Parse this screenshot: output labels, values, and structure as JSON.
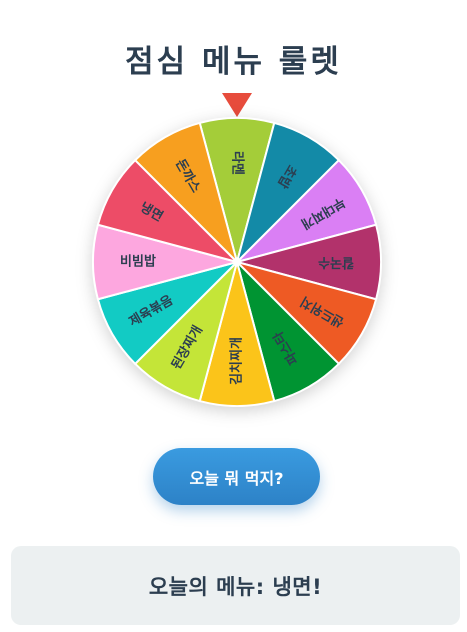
{
  "header": {
    "title": "점심 메뉴 룰렛"
  },
  "wheel": {
    "pointer_color": "#e74c3c",
    "segments": [
      {
        "label": "라멘",
        "color": "#a4cd39"
      },
      {
        "label": "초밥",
        "color": "#138aa7"
      },
      {
        "label": "부대찌개",
        "color": "#da7ff4"
      },
      {
        "label": "칼국수",
        "color": "#b2326b"
      },
      {
        "label": "샌드위치",
        "color": "#ee5a24"
      },
      {
        "label": "파스타",
        "color": "#009432"
      },
      {
        "label": "김치찌개",
        "color": "#fbc41a"
      },
      {
        "label": "된장찌개",
        "color": "#c4e538"
      },
      {
        "label": "제육볶음",
        "color": "#12cbc4"
      },
      {
        "label": "비빔밥",
        "color": "#fda7df"
      },
      {
        "label": "냉면",
        "color": "#ed4c67"
      },
      {
        "label": "돈까스",
        "color": "#f79f1f"
      }
    ]
  },
  "controls": {
    "spin_label": "오늘 뭐 먹지?"
  },
  "result": {
    "text": "오늘의 메뉴: 냉면!"
  }
}
